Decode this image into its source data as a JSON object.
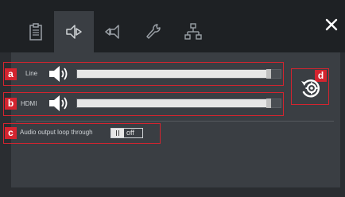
{
  "tabs": [
    {
      "icon": "clipboard-icon",
      "active": false
    },
    {
      "icon": "audio-output-icon",
      "active": true
    },
    {
      "icon": "audio-input-icon",
      "active": false
    },
    {
      "icon": "wrench-icon",
      "active": false
    },
    {
      "icon": "network-icon",
      "active": false
    }
  ],
  "close_icon": "close-icon",
  "markers": {
    "a": "a",
    "b": "b",
    "c": "c",
    "d": "d"
  },
  "rows": {
    "line": {
      "label": "Line",
      "volume": 0.94
    },
    "hdmi": {
      "label": "HDMI",
      "volume": 0.94
    }
  },
  "loop_through": {
    "label": "Audio output loop through",
    "state": "off"
  },
  "colors": {
    "callout_red": "#d4242f",
    "panel_bg": "#3a3e43",
    "tabbar_bg": "#1e2124"
  }
}
